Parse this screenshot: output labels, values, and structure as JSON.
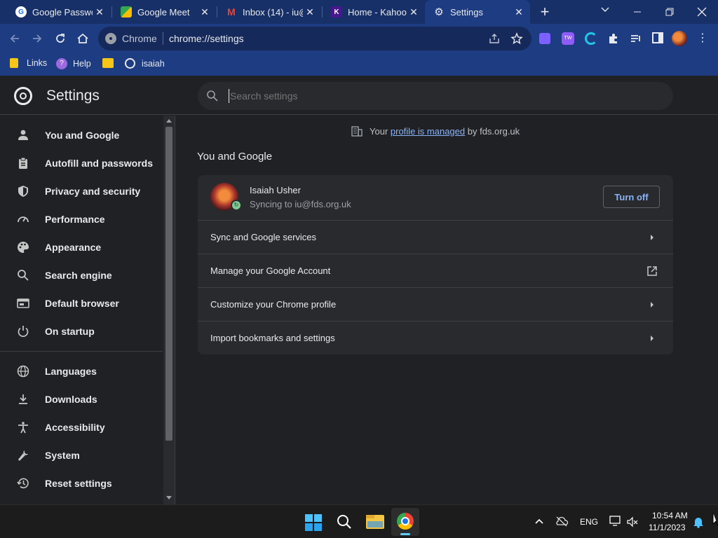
{
  "tabs": [
    {
      "title": "Google Passwo",
      "active": false
    },
    {
      "title": "Google Meet",
      "active": false
    },
    {
      "title": "Inbox (14) - iu@",
      "active": false
    },
    {
      "title": "Home - Kahoot!",
      "active": false
    },
    {
      "title": "Settings",
      "active": true
    }
  ],
  "omnibox": {
    "site_label": "Chrome",
    "url": "chrome://settings"
  },
  "bookmarks": [
    {
      "label": "Links"
    },
    {
      "label": "Help"
    },
    {
      "label": ""
    },
    {
      "label": "isaiah"
    }
  ],
  "settings": {
    "title": "Settings",
    "search_placeholder": "Search settings",
    "managed": {
      "prefix": "Your ",
      "link": "profile is managed",
      "suffix": " by fds.org.uk"
    },
    "section_title": "You and Google",
    "profile": {
      "name": "Isaiah Usher",
      "status": "Syncing to iu@fds.org.uk",
      "turn_off_label": "Turn off"
    },
    "rows": [
      {
        "label": "Sync and Google services",
        "end": "chevron-right-icon"
      },
      {
        "label": "Manage your Google Account",
        "end": "open-in-new-icon"
      },
      {
        "label": "Customize your Chrome profile",
        "end": "chevron-right-icon"
      },
      {
        "label": "Import bookmarks and settings",
        "end": "chevron-right-icon"
      }
    ],
    "nav": [
      {
        "label": "You and Google",
        "icon": "person-icon"
      },
      {
        "label": "Autofill and passwords",
        "icon": "clipboard-icon"
      },
      {
        "label": "Privacy and security",
        "icon": "shield-icon"
      },
      {
        "label": "Performance",
        "icon": "speedometer-icon"
      },
      {
        "label": "Appearance",
        "icon": "palette-icon"
      },
      {
        "label": "Search engine",
        "icon": "search-icon"
      },
      {
        "label": "Default browser",
        "icon": "browser-icon"
      },
      {
        "label": "On startup",
        "icon": "power-icon"
      },
      {
        "label": "Languages",
        "icon": "globe-icon"
      },
      {
        "label": "Downloads",
        "icon": "download-icon"
      },
      {
        "label": "Accessibility",
        "icon": "accessibility-icon"
      },
      {
        "label": "System",
        "icon": "wrench-icon"
      },
      {
        "label": "Reset settings",
        "icon": "history-icon"
      }
    ]
  },
  "taskbar": {
    "language": "ENG",
    "time": "10:54 AM",
    "date": "11/1/2023"
  },
  "colors": {
    "accent_link": "#8ab4f8",
    "tab_strip": "#183068",
    "toolbar": "#1e3c82",
    "page_bg": "#202124",
    "card_bg": "#292a2d"
  }
}
